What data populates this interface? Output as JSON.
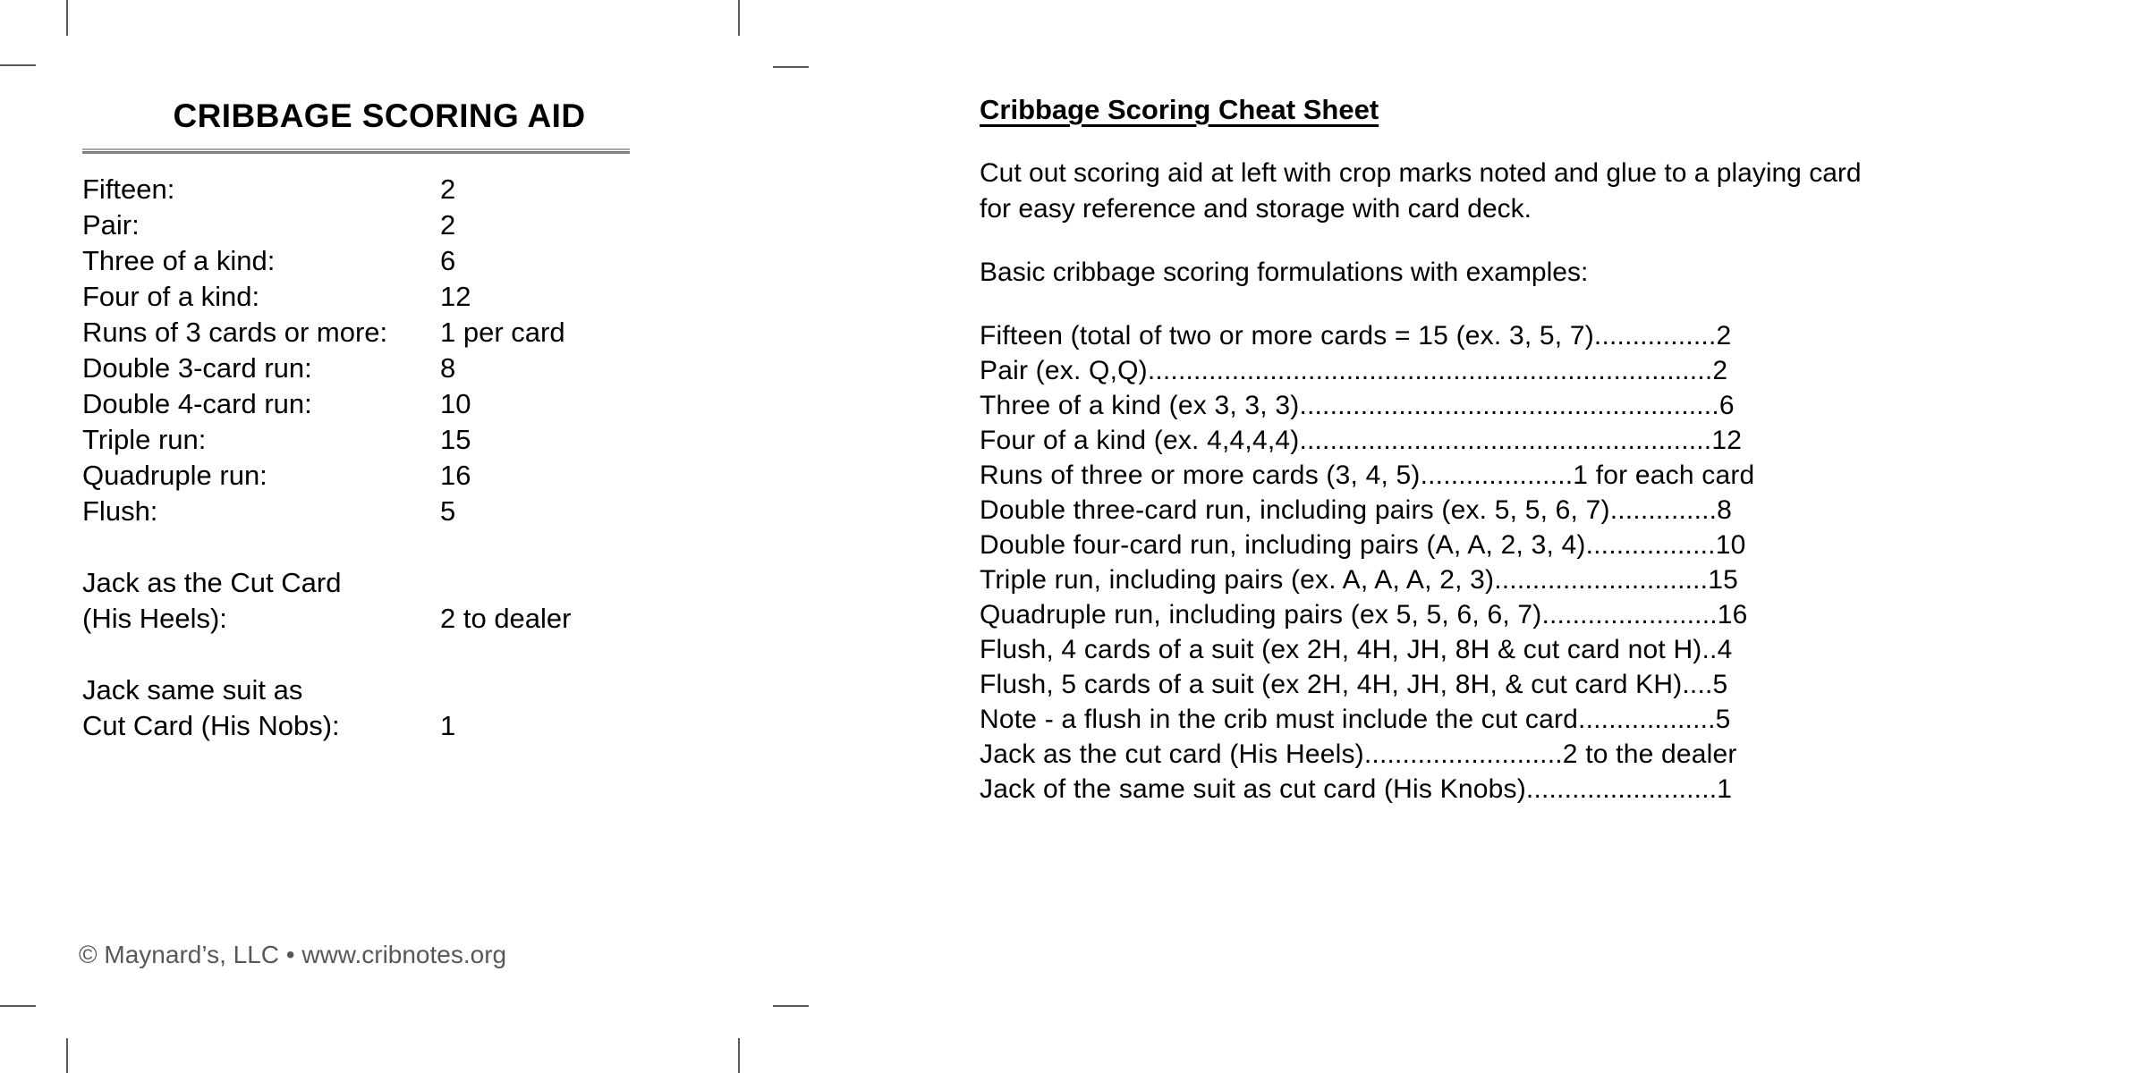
{
  "crop_marks": {
    "label": "printer-crop-marks",
    "color": "#5a5a5a"
  },
  "scoring_aid": {
    "title": "CRIBBAGE SCORING AID",
    "rows": [
      {
        "label": "Fifteen:",
        "value": "2"
      },
      {
        "label": "Pair:",
        "value": "2"
      },
      {
        "label": "Three of a kind:",
        "value": "6"
      },
      {
        "label": "Four of a kind:",
        "value": "12"
      },
      {
        "label": "Runs of 3 cards or more:",
        "value": "1 per card"
      },
      {
        "label": "Double 3-card run:",
        "value": "8"
      },
      {
        "label": "Double 4-card run:",
        "value": "10"
      },
      {
        "label": "Triple run:",
        "value": "15"
      },
      {
        "label": "Quadruple run:",
        "value": "16"
      },
      {
        "label": "Flush:",
        "value": "5"
      }
    ],
    "jack_heels": {
      "line1": "Jack as the Cut Card",
      "line2": "(His Heels):",
      "value": "2 to dealer"
    },
    "jack_nobs": {
      "line1": "Jack same suit as",
      "line2": "Cut Card (His Nobs):",
      "value": "1"
    },
    "footer": "© Maynard’s, LLC • www.cribnotes.org"
  },
  "cheat_sheet": {
    "heading": "Cribbage Scoring Cheat Sheet",
    "intro": "Cut out scoring aid at left with crop marks noted and glue to a playing card for easy reference and storage with card deck.",
    "lead_in": "Basic cribbage scoring formulations with examples:",
    "lines": [
      "Fifteen (total of two or more cards = 15 (ex. 3, 5, 7)................2",
      "Pair (ex. Q,Q)..........................................................................2",
      "Three of a kind (ex 3, 3, 3).......................................................6",
      "Four of a kind (ex. 4,4,4,4)......................................................12",
      "Runs of three or more cards (3, 4, 5)....................1 for each card",
      "Double three-card run, including pairs (ex. 5, 5, 6, 7)..............8",
      "Double four-card run, including pairs (A, A, 2, 3, 4).................10",
      "Triple run, including pairs (ex. A, A, A, 2, 3)............................15",
      "Quadruple run, including pairs (ex 5, 5, 6, 6, 7).......................16",
      "Flush, 4 cards of a suit (ex 2H, 4H, JH, 8H & cut card not H)..4",
      "Flush, 5 cards of a suit (ex 2H, 4H, JH, 8H, & cut card KH)....5",
      "Note - a flush in the crib must include the cut card..................5",
      "Jack as the cut card (His Heels)..........................2 to the dealer",
      "Jack of the same suit as cut card (His Knobs).........................1"
    ]
  }
}
